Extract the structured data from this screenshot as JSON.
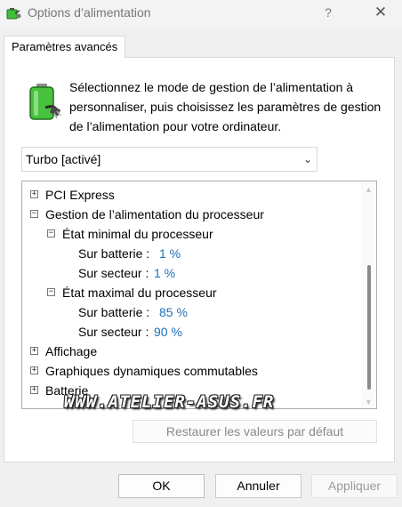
{
  "window": {
    "title": "Options d’alimentation",
    "help_glyph": "?",
    "close_glyph": "✕"
  },
  "tabs": [
    {
      "label": "Paramètres avancés"
    }
  ],
  "panel": {
    "description": "Sélectionnez le mode de gestion de l’alimentation à personnaliser, puis choisissez les paramètres de gestion de l’alimentation pour votre ordinateur.",
    "plan_select": {
      "value": "Turbo [activé]"
    }
  },
  "tree": {
    "items": [
      {
        "toggle": "+",
        "label": "PCI Express"
      },
      {
        "toggle": "−",
        "label": "Gestion de l’alimentation du processeur"
      },
      {
        "toggle": "−",
        "label": "État minimal du processeur"
      },
      {
        "label": "Sur batterie :",
        "value": "1 %"
      },
      {
        "label": "Sur secteur :",
        "value": "1 %"
      },
      {
        "toggle": "−",
        "label": "État maximal du processeur"
      },
      {
        "label": "Sur batterie :",
        "value": "85 %"
      },
      {
        "label": "Sur secteur :",
        "value": "90 %"
      },
      {
        "toggle": "+",
        "label": "Affichage"
      },
      {
        "toggle": "+",
        "label": "Graphiques dynamiques commutables"
      },
      {
        "toggle": "+",
        "label": "Batterie"
      }
    ]
  },
  "watermark": "WWW.ATELIER-ASUS.FR",
  "buttons": {
    "restore": "Restaurer les valeurs par défaut",
    "ok": "OK",
    "cancel": "Annuler",
    "apply": "Appliquer"
  },
  "colors": {
    "value_text": "#1e6fb8",
    "battery_green": "#3fbf3a"
  }
}
